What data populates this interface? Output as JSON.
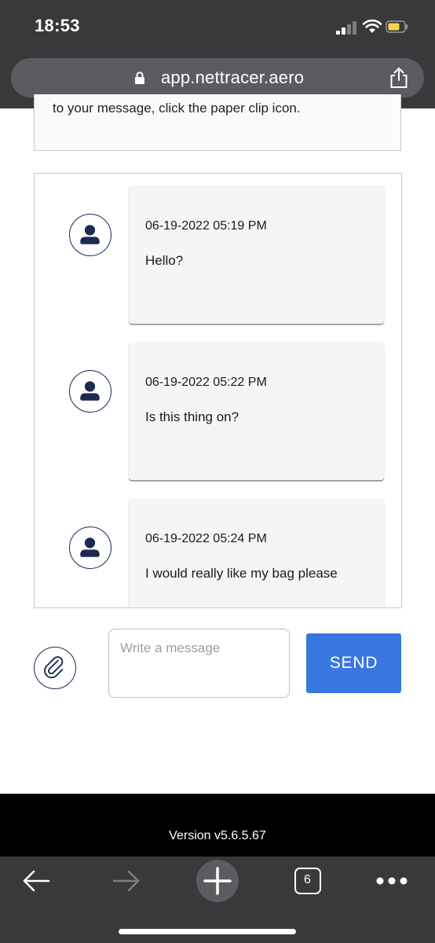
{
  "status_bar": {
    "time": "18:53",
    "icons": [
      "cellular-signal-icon",
      "wifi-icon",
      "battery-icon"
    ]
  },
  "browser": {
    "url": "app.nettracer.aero",
    "icons": [
      "lock-icon",
      "share-icon"
    ]
  },
  "page": {
    "notice_text": "to your message, click the paper clip icon.",
    "messages": [
      {
        "timestamp": "06-19-2022 05:19 PM",
        "text": "Hello?"
      },
      {
        "timestamp": "06-19-2022 05:22 PM",
        "text": "Is this thing on?"
      },
      {
        "timestamp": "06-19-2022 05:24 PM",
        "text": "I would really like my bag please"
      }
    ],
    "composer": {
      "placeholder": "Write a message",
      "value": "",
      "send_label": "SEND"
    },
    "footer": {
      "version": "Version v5.6.5.67"
    }
  },
  "toolbar": {
    "tab_count": "6",
    "icons": [
      "back-arrow-icon",
      "forward-arrow-icon",
      "new-tab-plus-icon",
      "tabs-icon",
      "more-icon"
    ]
  },
  "colors": {
    "browser_chrome": "#38393b",
    "url_bar": "#5b5c5f",
    "send_button": "#3a76df",
    "avatar_navy": "#1c2a52",
    "bubble": "#f5f5f5",
    "battery": "#f5d94a",
    "footer": "#000000"
  }
}
